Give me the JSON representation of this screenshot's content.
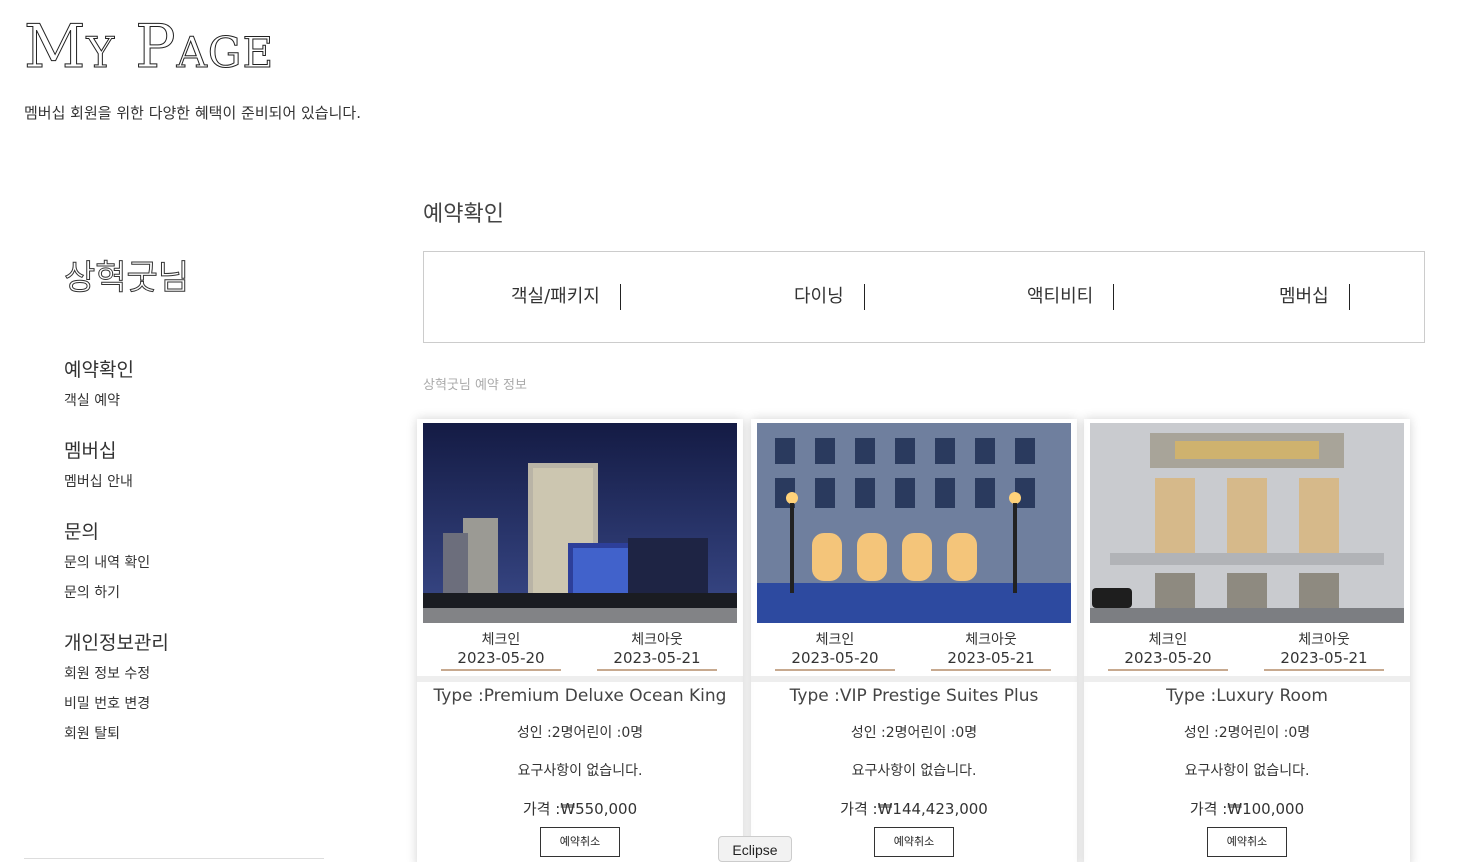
{
  "page": {
    "title": "My Page",
    "subtitle": "멤버십 회원을 위한 다양한 혜택이 준비되어 있습니다."
  },
  "sidebar": {
    "user_name": "상혁굿님",
    "groups": [
      {
        "heading": "예약확인",
        "links": [
          "객실 예약"
        ]
      },
      {
        "heading": "멤버십",
        "links": [
          "멤버십 안내"
        ]
      },
      {
        "heading": "문의",
        "links": [
          "문의 내역 확인",
          "문의 하기"
        ]
      },
      {
        "heading": "개인정보관리",
        "links": [
          "회원 정보 수정",
          "비밀 번호 변경",
          "회원 탈퇴"
        ]
      }
    ]
  },
  "main": {
    "section_title": "예약확인",
    "tabs": [
      "객실/패키지",
      "다이닝",
      "액티비티",
      "멤버십"
    ],
    "info_label": "상혁굿님 예약 정보"
  },
  "cards": [
    {
      "checkin_label": "체크인",
      "checkin": "2023-05-20",
      "checkout_label": "체크아웃",
      "checkout": "2023-05-21",
      "type": "Type :Premium Deluxe Ocean King",
      "guests": "성인 :2명어린이 :0명",
      "request": "요구사항이 없습니다.",
      "price": "가격 :₩550,000",
      "cancel": "예약취소",
      "image": "night-hotel-towers"
    },
    {
      "checkin_label": "체크인",
      "checkin": "2023-05-20",
      "checkout_label": "체크아웃",
      "checkout": "2023-05-21",
      "type": "Type :VIP Prestige Suites Plus",
      "guests": "성인 :2명어린이 :0명",
      "request": "요구사항이 없습니다.",
      "price": "가격 :₩144,423,000",
      "cancel": "예약취소",
      "image": "classic-facade-dusk"
    },
    {
      "checkin_label": "체크인",
      "checkin": "2023-05-20",
      "checkout_label": "체크아웃",
      "checkout": "2023-05-21",
      "type": "Type :Luxury Room",
      "guests": "성인 :2명어린이 :0명",
      "request": "요구사항이 없습니다.",
      "price": "가격 :₩100,000",
      "cancel": "예약취소",
      "image": "art-deco-entrance"
    }
  ],
  "tooltip": "Eclipse"
}
